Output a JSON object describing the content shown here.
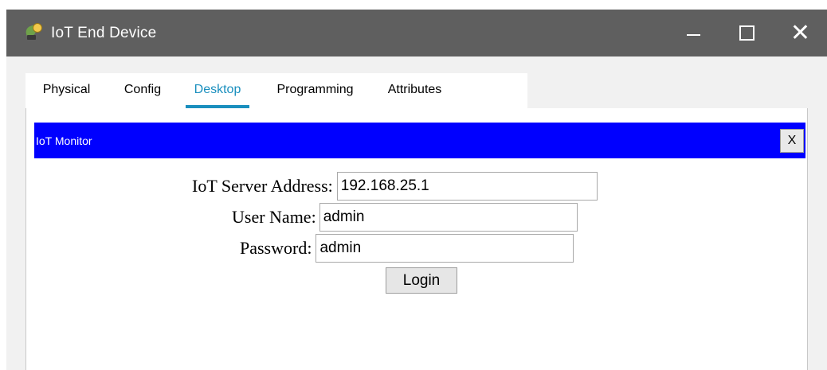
{
  "window": {
    "title": "IoT End Device",
    "controls": {
      "minimize": "minimize",
      "maximize": "maximize",
      "close": "✕"
    }
  },
  "tabs": [
    {
      "label": "Physical",
      "active": false
    },
    {
      "label": "Config",
      "active": false
    },
    {
      "label": "Desktop",
      "active": true
    },
    {
      "label": "Programming",
      "active": false
    },
    {
      "label": "Attributes",
      "active": false
    }
  ],
  "iot_monitor": {
    "title": "IoT Monitor",
    "close_label": "X",
    "header_color": "#0000ff",
    "server_address_label": "IoT Server Address:",
    "server_address_value": "192.168.25.1",
    "username_label": "User Name:",
    "username_value": "admin",
    "password_label": "Password:",
    "password_value": "admin",
    "login_label": "Login"
  },
  "colors": {
    "accent": "#1a8fbe",
    "titlebar": "#5f5f5f"
  }
}
